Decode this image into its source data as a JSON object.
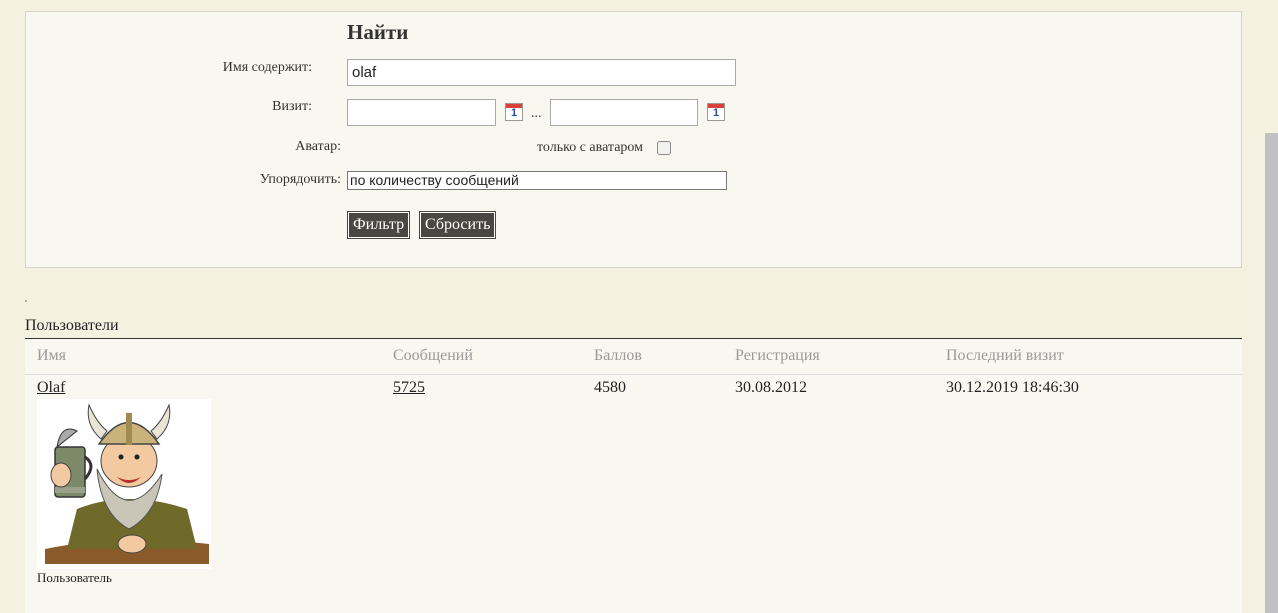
{
  "search": {
    "title": "Найти",
    "name_label": "Имя содержит:",
    "name_value": "olaf",
    "visit_label": "Визит:",
    "visit_from": "",
    "visit_to": "",
    "visit_separator": "...",
    "calendar_day": "1",
    "avatar_label": "Аватар:",
    "avatar_only_label": "только с аватаром",
    "avatar_only_checked": false,
    "order_label": "Упорядочить:",
    "order_value": "по количеству сообщений",
    "filter_button": "Фильтр",
    "reset_button": "Сбросить"
  },
  "users": {
    "section_title": "Пользователи",
    "columns": [
      "Имя",
      "Сообщений",
      "Баллов",
      "Регистрация",
      "Последний визит"
    ],
    "rows": [
      {
        "name": "Olaf",
        "messages": "5725",
        "points": "4580",
        "registered": "30.08.2012",
        "last_visit": "30.12.2019 18:46:30",
        "role": "Пользователь",
        "avatar_icon": "viking-avatar"
      }
    ]
  },
  "colors": {
    "page_bg": "#f4f1e1",
    "panel_bg": "#f9f8f0",
    "button_bg": "#4a4641"
  }
}
